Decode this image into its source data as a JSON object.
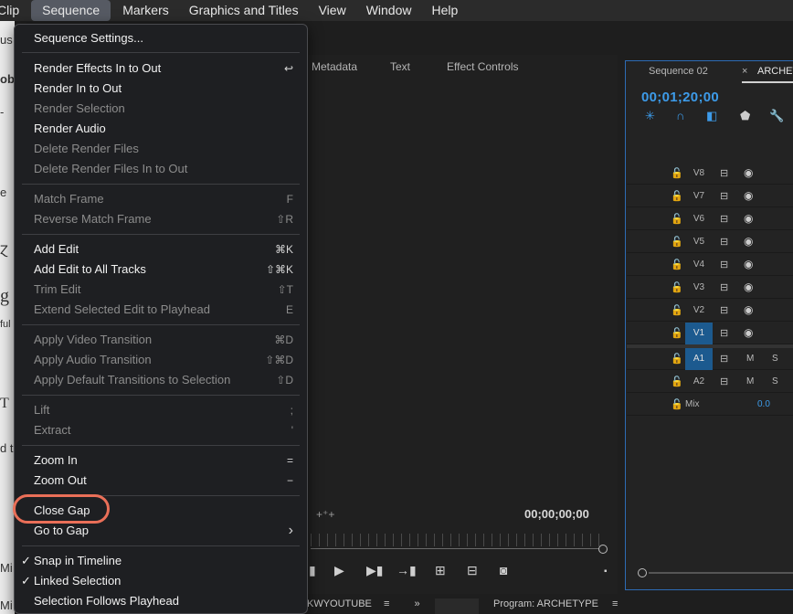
{
  "menubar": {
    "items": [
      "Clip",
      "Sequence",
      "Markers",
      "Graphics and Titles",
      "View",
      "Window",
      "Help"
    ],
    "active": "Sequence"
  },
  "background": {
    "fragments": [
      "us",
      "ob",
      "-",
      "e",
      "Ɀ",
      "g",
      "ful",
      "T",
      "d t",
      "Mi",
      "Mi"
    ]
  },
  "source_tabs": [
    "Metadata",
    "Text",
    "Effect Controls"
  ],
  "source_timecode": "00;00;00;00",
  "timeline": {
    "tab_sequence": "Sequence 02",
    "tab_close": "×",
    "tab_active": "ARCHETYPE",
    "timecode": "00;01;20;00",
    "video_tracks": [
      "V8",
      "V7",
      "V6",
      "V5",
      "V4",
      "V3",
      "V2",
      "V1"
    ],
    "audio_tracks": [
      "A1",
      "A2"
    ],
    "mute_label": "M",
    "solo_label": "S",
    "mix_label": "Mix",
    "mix_value": "0.0"
  },
  "bottom": {
    "left_panel": "KWYOUTUBE",
    "right_panel": "Program: ARCHETYPE",
    "menu_glyph": "≡",
    "more_glyph": "»"
  },
  "menu": {
    "items": [
      {
        "label": "Sequence Settings...",
        "shortcut": "",
        "enabled": true
      },
      {
        "label": "Render Effects In to Out",
        "shortcut": "↩",
        "enabled": true
      },
      {
        "label": "Render In to Out",
        "shortcut": "",
        "enabled": true
      },
      {
        "label": "Render Selection",
        "shortcut": "",
        "enabled": false
      },
      {
        "label": "Render Audio",
        "shortcut": "",
        "enabled": true
      },
      {
        "label": "Delete Render Files",
        "shortcut": "",
        "enabled": false
      },
      {
        "label": "Delete Render Files In to Out",
        "shortcut": "",
        "enabled": false
      },
      {
        "label": "Match Frame",
        "shortcut": "F",
        "enabled": false
      },
      {
        "label": "Reverse Match Frame",
        "shortcut": "⇧R",
        "enabled": false
      },
      {
        "label": "Add Edit",
        "shortcut": "⌘K",
        "enabled": true
      },
      {
        "label": "Add Edit to All Tracks",
        "shortcut": "⇧⌘K",
        "enabled": true
      },
      {
        "label": "Trim Edit",
        "shortcut": "⇧T",
        "enabled": false
      },
      {
        "label": "Extend Selected Edit to Playhead",
        "shortcut": "E",
        "enabled": false
      },
      {
        "label": "Apply Video Transition",
        "shortcut": "⌘D",
        "enabled": false
      },
      {
        "label": "Apply Audio Transition",
        "shortcut": "⇧⌘D",
        "enabled": false
      },
      {
        "label": "Apply Default Transitions to Selection",
        "shortcut": "⇧D",
        "enabled": false
      },
      {
        "label": "Lift",
        "shortcut": ";",
        "enabled": false
      },
      {
        "label": "Extract",
        "shortcut": "'",
        "enabled": false
      },
      {
        "label": "Zoom In",
        "shortcut": "=",
        "enabled": true
      },
      {
        "label": "Zoom Out",
        "shortcut": "−",
        "enabled": true
      },
      {
        "label": "Close Gap",
        "shortcut": "",
        "enabled": true
      },
      {
        "label": "Go to Gap",
        "shortcut": "›",
        "enabled": true
      },
      {
        "label": "Snap in Timeline",
        "shortcut": "",
        "enabled": true,
        "checked": true
      },
      {
        "label": "Linked Selection",
        "shortcut": "",
        "enabled": true,
        "checked": true
      },
      {
        "label": "Selection Follows Playhead",
        "shortcut": "",
        "enabled": true
      }
    ],
    "check_glyph": "✓",
    "annotation": {
      "highlighted_item": "Close Gap",
      "color": "#ea6f58"
    }
  }
}
